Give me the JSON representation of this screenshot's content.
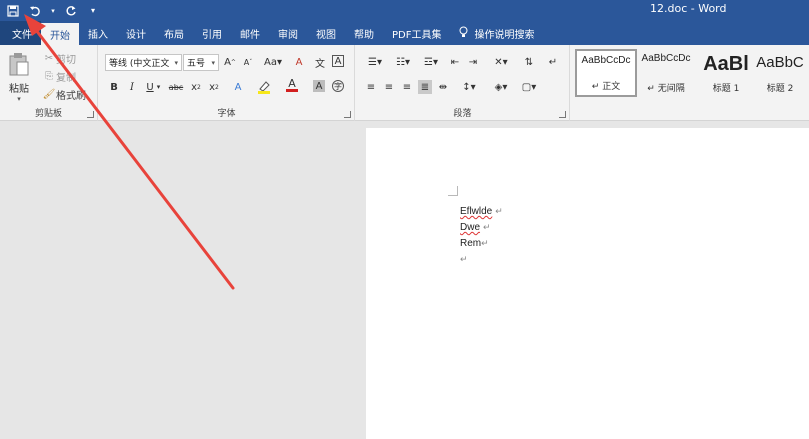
{
  "titlebar": {
    "doc_title": "12.doc  -  Word",
    "qat": [
      {
        "name": "save-icon",
        "glyph": "🖫"
      },
      {
        "name": "undo-icon",
        "glyph": "↶"
      },
      {
        "name": "redo-icon",
        "glyph": "↻"
      },
      {
        "name": "customize-qat-icon",
        "glyph": "▾"
      }
    ]
  },
  "tabs": {
    "file": "文件",
    "home": "开始",
    "insert": "插入",
    "design": "设计",
    "layout": "布局",
    "references": "引用",
    "mailings": "邮件",
    "review": "审阅",
    "view": "视图",
    "help": "帮助",
    "pdf": "PDF工具集",
    "tellme": "操作说明搜索"
  },
  "ribbon": {
    "clipboard": {
      "label": "剪贴板",
      "paste": "粘贴",
      "cut": "剪切",
      "copy": "复制",
      "format_painter": "格式刷"
    },
    "font": {
      "label": "字体",
      "font_name": "等线 (中文正文",
      "font_size": "五号"
    },
    "paragraph": {
      "label": "段落"
    },
    "styles": {
      "items": [
        {
          "preview": "AaBbCcDc",
          "name": "↵ 正文"
        },
        {
          "preview": "AaBbCcDc",
          "name": "↵ 无间隔"
        },
        {
          "preview": "AaBl",
          "name": "标题 1"
        },
        {
          "preview": "AaBbC",
          "name": "标题 2"
        }
      ]
    }
  },
  "document": {
    "lines": [
      {
        "text": "Eflwlde",
        "mark": "↵"
      },
      {
        "text": "Dwe",
        "mark": "↵"
      },
      {
        "text": "Rem",
        "mark": "↵"
      },
      {
        "text": "",
        "mark": "↵"
      }
    ]
  },
  "colors": {
    "title_blue": "#2b579a",
    "file_tab": "#1f467d",
    "arrow_red": "#e8433b"
  }
}
